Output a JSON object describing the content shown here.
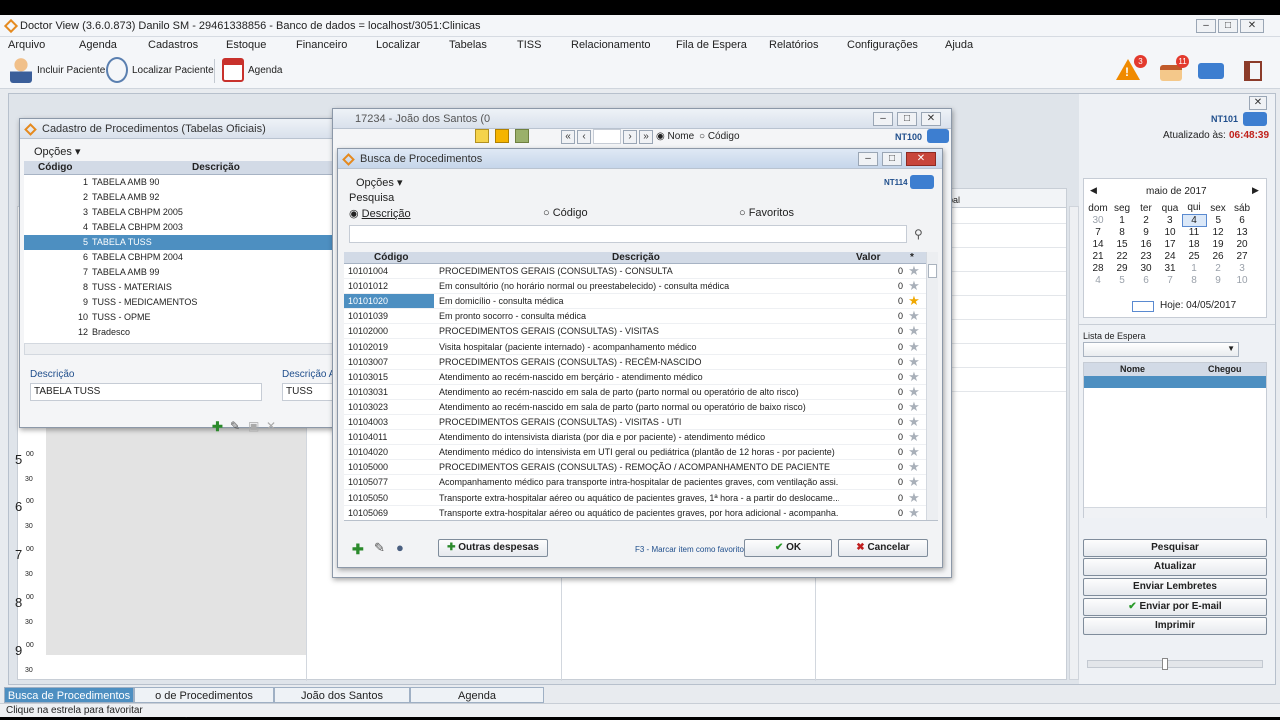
{
  "app": {
    "title": "Doctor View (3.6.0.873) Danilo SM - 29461338856  -  Banco de dados = localhost/3051:Clinicas"
  },
  "menu": [
    "Arquivo",
    "Agenda",
    "Cadastros",
    "Estoque",
    "Financeiro",
    "Localizar",
    "Tabelas",
    "TISS",
    "Relacionamento",
    "Fila de Espera",
    "Relatórios",
    "Configurações",
    "Ajuda"
  ],
  "toolbar": {
    "incluir_paciente": "Incluir Paciente",
    "localizar_paciente": "Localizar Paciente",
    "agenda": "Agenda",
    "badge_alert": "3",
    "badge_birthday": "11"
  },
  "cadastro": {
    "title": "Cadastro de Procedimentos (Tabelas Oficiais)",
    "opcoes": "Opções",
    "col_codigo": "Código",
    "col_descricao": "Descrição",
    "rows": [
      {
        "codigo": "1",
        "descricao": "TABELA AMB 90"
      },
      {
        "codigo": "2",
        "descricao": "TABELA AMB 92"
      },
      {
        "codigo": "3",
        "descricao": "TABELA CBHPM 2005"
      },
      {
        "codigo": "4",
        "descricao": "TABELA CBHPM 2003"
      },
      {
        "codigo": "5",
        "descricao": "TABELA TUSS"
      },
      {
        "codigo": "6",
        "descricao": "TABELA CBHPM 2004"
      },
      {
        "codigo": "7",
        "descricao": "TABELA AMB 99"
      },
      {
        "codigo": "8",
        "descricao": "TUSS - MATERIAIS"
      },
      {
        "codigo": "9",
        "descricao": "TUSS - MEDICAMENTOS"
      },
      {
        "codigo": "10",
        "descricao": "TUSS - OPME"
      },
      {
        "codigo": "12",
        "descricao": "Bradesco"
      }
    ],
    "selected_index": 4,
    "descricao_label": "Descrição",
    "descricao_value": "TABELA TUSS",
    "descricao_ab_label": "Descrição Ab",
    "descricao_ab_value": "TUSS"
  },
  "paciente_window": {
    "title": "17234 - João dos Santos (0",
    "radio_nome": "Nome",
    "radio_codigo": "Código",
    "nt": "NT100"
  },
  "busca": {
    "title": "Busca de Procedimentos",
    "opcoes": "Opções",
    "nt": "NT114",
    "pesquisa_label": "Pesquisa",
    "radio_descricao": "Descrição",
    "radio_codigo": "Código",
    "radio_favoritos": "Favoritos",
    "search_value": "",
    "col_codigo": "Código",
    "col_descricao": "Descrição",
    "col_valor": "Valor",
    "col_fav": "*",
    "selected_index": 2,
    "rows": [
      {
        "codigo": "10101004",
        "descricao": "PROCEDIMENTOS GERAIS (CONSULTAS) - CONSULTA",
        "valor": "0"
      },
      {
        "codigo": "10101012",
        "descricao": "Em consultório (no horário normal ou preestabelecido) - consulta médica",
        "valor": "0"
      },
      {
        "codigo": "10101020",
        "descricao": "Em domicílio - consulta médica",
        "valor": "0"
      },
      {
        "codigo": "10101039",
        "descricao": "Em pronto socorro - consulta médica",
        "valor": "0"
      },
      {
        "codigo": "10102000",
        "descricao": "PROCEDIMENTOS GERAIS (CONSULTAS) - VISITAS",
        "valor": "0"
      },
      {
        "codigo": "10102019",
        "descricao": "Visita hospitalar (paciente internado) - acompanhamento médico",
        "valor": "0"
      },
      {
        "codigo": "10103007",
        "descricao": "PROCEDIMENTOS GERAIS (CONSULTAS) - RECÉM-NASCIDO",
        "valor": "0"
      },
      {
        "codigo": "10103015",
        "descricao": "Atendimento ao recém-nascido em berçário - atendimento médico",
        "valor": "0"
      },
      {
        "codigo": "10103031",
        "descricao": "Atendimento ao recém-nascido em sala de parto (parto normal ou operatório de alto risco)",
        "valor": "0"
      },
      {
        "codigo": "10103023",
        "descricao": "Atendimento ao recém-nascido em sala de parto (parto normal ou operatório de baixo risco)",
        "valor": "0"
      },
      {
        "codigo": "10104003",
        "descricao": "PROCEDIMENTOS GERAIS (CONSULTAS) - VISITAS - UTI",
        "valor": "0"
      },
      {
        "codigo": "10104011",
        "descricao": "Atendimento do intensivista diarista (por dia e por paciente) - atendimento médico",
        "valor": "0"
      },
      {
        "codigo": "10104020",
        "descricao": "Atendimento médico do intensivista em UTI geral ou pediátrica (plantão de 12 horas - por paciente)",
        "valor": "0"
      },
      {
        "codigo": "10105000",
        "descricao": "PROCEDIMENTOS GERAIS (CONSULTAS) - REMOÇÃO / ACOMPANHAMENTO DE PACIENTE",
        "valor": "0"
      },
      {
        "codigo": "10105077",
        "descricao": "Acompanhamento médico para transporte intra-hospitalar de pacientes graves, com ventilação assi...",
        "valor": "0"
      },
      {
        "codigo": "10105050",
        "descricao": "Transporte extra-hospitalar aéreo ou aquático de pacientes graves, 1ª hora - a partir do deslocame...",
        "valor": "0"
      },
      {
        "codigo": "10105069",
        "descricao": "Transporte extra-hospitalar aéreo ou aquático de pacientes graves, por hora adicional - acompanha...",
        "valor": "0"
      }
    ],
    "outras_despesas": "Outras despesas",
    "hint": "F3 - Marcar item como favorito",
    "ok": "OK",
    "cancelar": "Cancelar"
  },
  "right_panel": {
    "nt": "NT101",
    "atualizado_label": "Atualizado às:",
    "atualizado_time": "06:48:39",
    "calendar_month": "maio de 2017",
    "weekdays": [
      "dom",
      "seg",
      "ter",
      "qua",
      "qui",
      "sex",
      "sáb"
    ],
    "weeks": [
      [
        "30",
        "1",
        "2",
        "3",
        "4",
        "5",
        "6"
      ],
      [
        "7",
        "8",
        "9",
        "10",
        "11",
        "12",
        "13"
      ],
      [
        "14",
        "15",
        "16",
        "17",
        "18",
        "19",
        "20"
      ],
      [
        "21",
        "22",
        "23",
        "24",
        "25",
        "26",
        "27"
      ],
      [
        "28",
        "29",
        "30",
        "31",
        "1",
        "2",
        "3"
      ],
      [
        "4",
        "5",
        "6",
        "7",
        "8",
        "9",
        "10"
      ]
    ],
    "hoje": "Hoje: 04/05/2017",
    "lista_espera_label": "Lista de Espera",
    "col_nome": "Nome",
    "col_chegou": "Chegou",
    "buttons": {
      "pesquisar": "Pesquisar",
      "atualizar": "Atualizar",
      "enviar_lembretes": "Enviar Lembretes",
      "enviar_email": "Enviar por E-mail",
      "imprimir": "Imprimir"
    }
  },
  "agenda_column_label": "pal",
  "times": [
    {
      "h": "5",
      "m": "00"
    },
    {
      "h": "6",
      "m": "00"
    },
    {
      "h": "7",
      "m": "00"
    },
    {
      "h": "8",
      "m": "00"
    },
    {
      "h": "9",
      "m": "00"
    }
  ],
  "half_label": "30",
  "tabs": [
    "Busca de Procedimentos",
    "o de Procedimentos (Tabelas",
    "João dos Santos",
    "Agenda"
  ],
  "status": "Clique na estrela para favoritar",
  "colors": {
    "selection": "#4d8fc1",
    "accent_orange": "#e58a1f",
    "time_red": "#c0201a"
  }
}
